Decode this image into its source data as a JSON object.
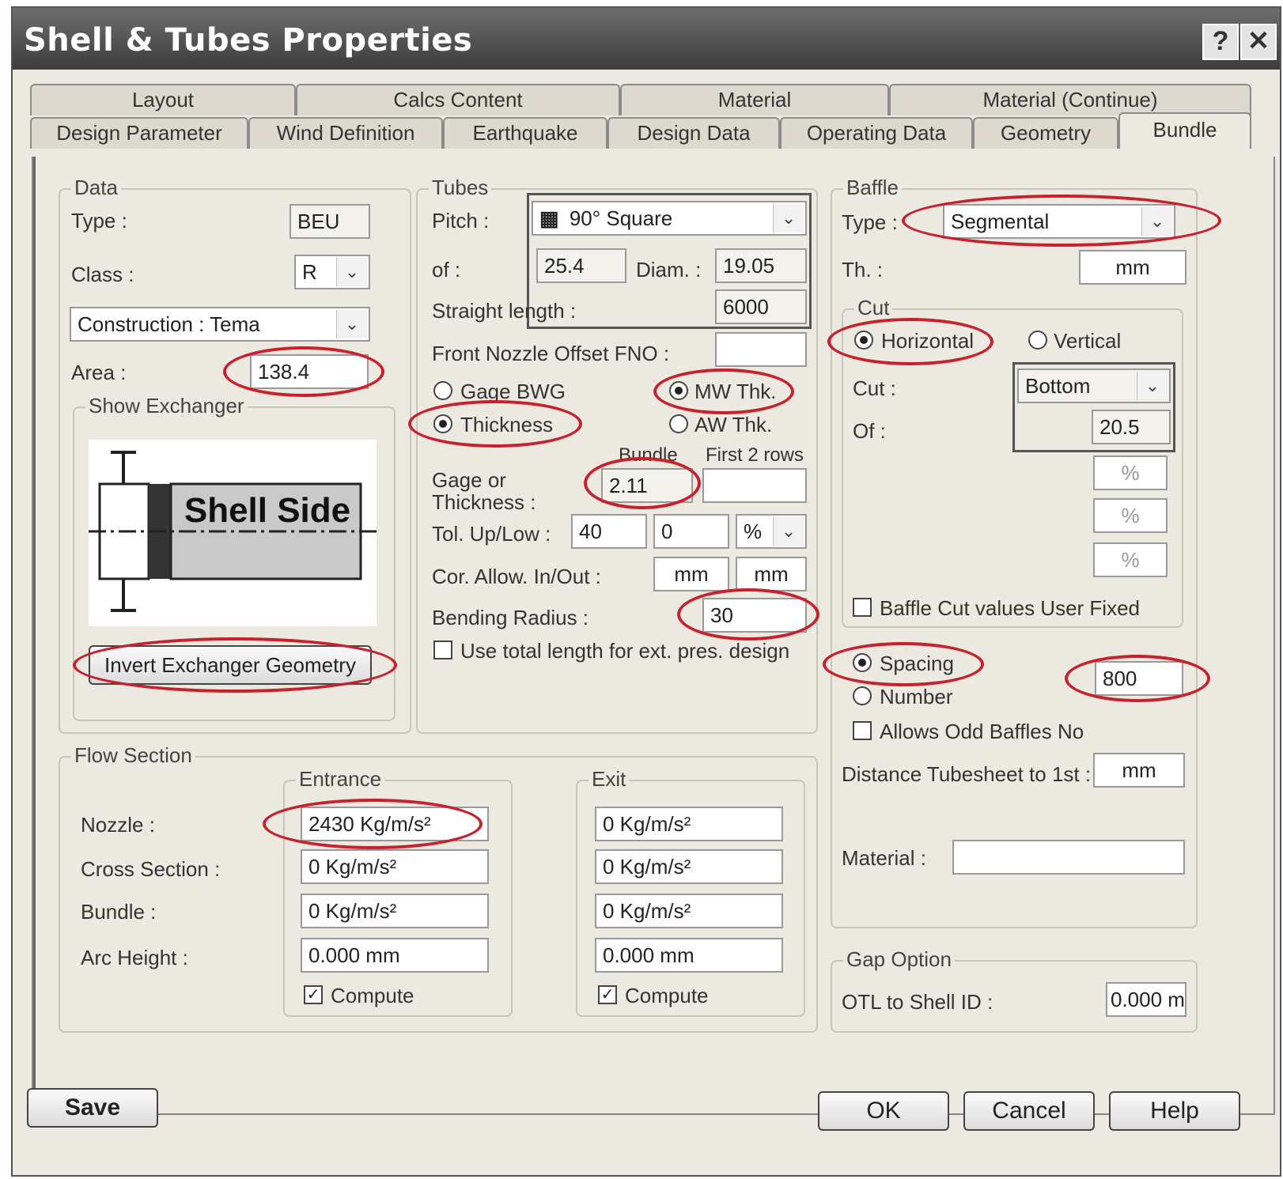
{
  "window": {
    "title": "Shell & Tubes Properties",
    "help_glyph": "?",
    "close_glyph": "✕"
  },
  "tabs": {
    "row1": [
      "Layout",
      "Calcs Content",
      "Material",
      "Material (Continue)"
    ],
    "row2": [
      "Design Parameter",
      "Wind Definition",
      "Earthquake",
      "Design Data",
      "Operating Data",
      "Geometry",
      "Bundle"
    ]
  },
  "data_group": {
    "legend": "Data",
    "type_label": "Type :",
    "type_value": "BEU",
    "class_label": "Class :",
    "class_value": "R",
    "construction_value": "Construction : Tema",
    "area_label": "Area :",
    "area_value": "138.4",
    "show_exchanger_legend": "Show Exchanger",
    "shell_side_text": "Shell Side",
    "invert_button": "Invert Exchanger Geometry"
  },
  "tubes_group": {
    "legend": "Tubes",
    "pitch_label": "Pitch :",
    "pitch_value": "90° Square",
    "of_label": "of :",
    "of_value": "25.4",
    "diam_label": "Diam. :",
    "diam_value": "19.05",
    "straight_label": "Straight length :",
    "straight_value": "6000",
    "fno_label": "Front Nozzle Offset FNO :",
    "fno_value": "",
    "gage_bwg": "Gage BWG",
    "mw_thk": "MW Thk.",
    "thickness": "Thickness",
    "aw_thk": "AW Thk.",
    "bundle_header": "Bundle",
    "first2_header": "First 2 rows",
    "gage_label_1": "Gage or",
    "gage_label_2": "Thickness :",
    "gage_bundle_value": "2.11",
    "gage_first2_value": "",
    "tol_label": "Tol. Up/Low :",
    "tol_up": "40",
    "tol_low": "0",
    "tol_unit": "%",
    "cor_label": "Cor. Allow. In/Out :",
    "cor_in": "mm",
    "cor_out": "mm",
    "bending_label": "Bending Radius :",
    "bending_value": "30",
    "use_total_label": "Use total length for ext. pres. design"
  },
  "baffle_group": {
    "legend": "Baffle",
    "type_label": "Type :",
    "type_value": "Segmental",
    "th_label": "Th. :",
    "th_value": "mm",
    "cut_legend": "Cut",
    "horizontal": "Horizontal",
    "vertical": "Vertical",
    "cut_label": "Cut :",
    "cut_value": "Bottom",
    "of_label": "Of :",
    "of_value": "20.5",
    "pct1": "%",
    "pct2": "%",
    "pct3": "%",
    "user_fixed_label": "Baffle Cut values User Fixed",
    "spacing": "Spacing",
    "spacing_value": "800",
    "number": "Number",
    "odd_label": "Allows Odd Baffles No",
    "distance_label": "Distance Tubesheet to 1st :",
    "distance_value": "mm",
    "material_label": "Material :",
    "material_value": ""
  },
  "gap_group": {
    "legend": "Gap Option",
    "otl_label": "OTL to Shell ID :",
    "otl_value": "0.000 m"
  },
  "flow_group": {
    "legend": "Flow Section",
    "entrance_legend": "Entrance",
    "exit_legend": "Exit",
    "nozzle_label": "Nozzle :",
    "cross_label": "Cross Section :",
    "bundle_label": "Bundle :",
    "arc_label": "Arc Height :",
    "entrance": {
      "nozzle": "2430 Kg/m/s²",
      "cross": "0 Kg/m/s²",
      "bundle": "0 Kg/m/s²",
      "arc": "0.000 mm",
      "compute": "Compute"
    },
    "exit": {
      "nozzle": "0 Kg/m/s²",
      "cross": "0 Kg/m/s²",
      "bundle": "0 Kg/m/s²",
      "arc": "0.000 mm",
      "compute": "Compute"
    }
  },
  "footer": {
    "save": "Save",
    "ok": "OK",
    "cancel": "Cancel",
    "help": "Help"
  },
  "colors": {
    "highlight_oval": "#c8202c",
    "titlebar": "#4a4a4a",
    "dialog_bg": "#ece9e0"
  },
  "icons": {
    "dropdown": "chevron-down-icon",
    "pitch": "square-pitch-icon",
    "check": "checkmark-icon"
  }
}
